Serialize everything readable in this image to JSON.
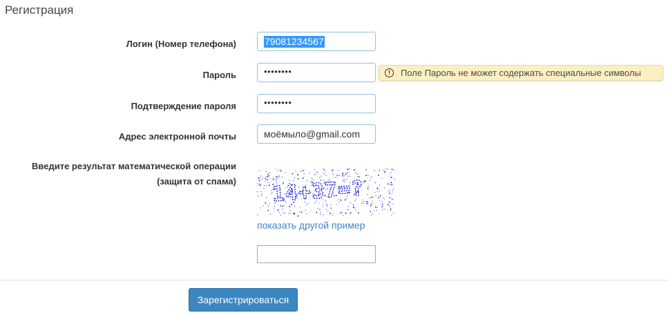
{
  "page": {
    "title": "Регистрация"
  },
  "form": {
    "login": {
      "label": "Логин (Номер телефона)",
      "value": "79081234567"
    },
    "password": {
      "label": "Пароль",
      "value_masked": "••••••••",
      "error_tooltip": "Поле Пароль не может содержать специальные символы"
    },
    "password_confirm": {
      "label": "Подтверждение пароля",
      "value_masked": "••••••••"
    },
    "email": {
      "label": "Адрес электронной почты",
      "value": "моёмыло@gmail.com"
    },
    "captcha": {
      "label_line1": "Введите результат математической операции",
      "label_line2": "(защита от спама)",
      "image_text": "14+37=?",
      "refresh_link": "показать другой пример",
      "answer_value": ""
    },
    "submit_label": "Зарегистрироваться"
  },
  "colors": {
    "accent": "#3a87c2",
    "link": "#3d85c6",
    "tooltip_bg": "#fcf0c3",
    "captcha_ink": "#1a1ad6"
  },
  "icons": {
    "tooltip_icon": "warning-circle-icon"
  }
}
